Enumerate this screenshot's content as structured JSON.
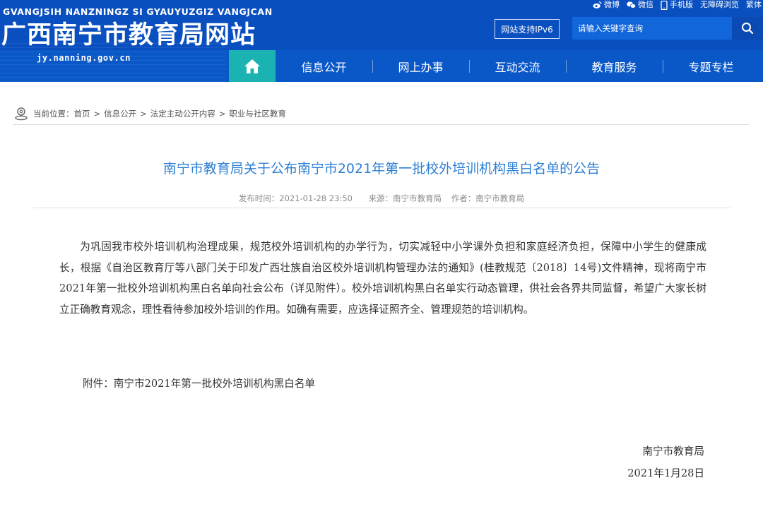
{
  "header": {
    "pinyin": "GVANGJSIH NANZNINGZ SI GYAUYUZGIZ VANGJCAN",
    "title": "广西南宁市教育局网站",
    "domain": "jy.nanning.gov.cn",
    "top_links": [
      {
        "label": "微博",
        "icon": "weibo-icon"
      },
      {
        "label": "微信",
        "icon": "wechat-icon"
      },
      {
        "label": "手机版",
        "icon": "mobile-icon"
      },
      {
        "label": "无障碍浏览",
        "icon": ""
      },
      {
        "label": "繁体",
        "icon": ""
      }
    ],
    "ipv6_label": "网站支持IPv6",
    "search_placeholder": "请输入关键字查询"
  },
  "nav": {
    "home_icon": "home-icon",
    "items": [
      "信息公开",
      "网上办事",
      "互动交流",
      "教育服务",
      "专题专栏"
    ]
  },
  "breadcrumb": {
    "prefix": "当前位置：",
    "items": [
      "首页",
      "信息公开",
      "法定主动公开内容",
      "职业与社区教育"
    ],
    "separator": ">"
  },
  "article": {
    "title": "南宁市教育局关于公布南宁市2021年第一批校外培训机构黑白名单的公告",
    "publish_time": "发布时间：2021-01-28 23:50",
    "source": "来源：南宁市教育局",
    "author": "作者：南宁市教育局",
    "body": "为巩固我市校外培训机构治理成果，规范校外培训机构的办学行为，切实减轻中小学课外负担和家庭经济负担，保障中小学生的健康成长，根据《自治区教育厅等八部门关于印发广西壮族自治区校外培训机构管理办法的通知》(桂教规范〔2018〕14号)文件精神，现将南宁市2021年第一批校外培训机构黑白名单向社会公布（详见附件）。校外培训机构黑白名单实行动态管理，供社会各界共同监督，希望广大家长树立正确教育观念，理性看待参加校外培训的作用。如确有需要，应选择证照齐全、管理规范的培训机构。",
    "attachment": "附件：南宁市2021年第一批校外培训机构黑白名单",
    "signature_org": "南宁市教育局",
    "signature_date": "2021年1月28日"
  },
  "colors": {
    "header_bg": "#0a4fbf",
    "home_bg": "#1bb3b1",
    "title_color": "#2d7fd3"
  }
}
